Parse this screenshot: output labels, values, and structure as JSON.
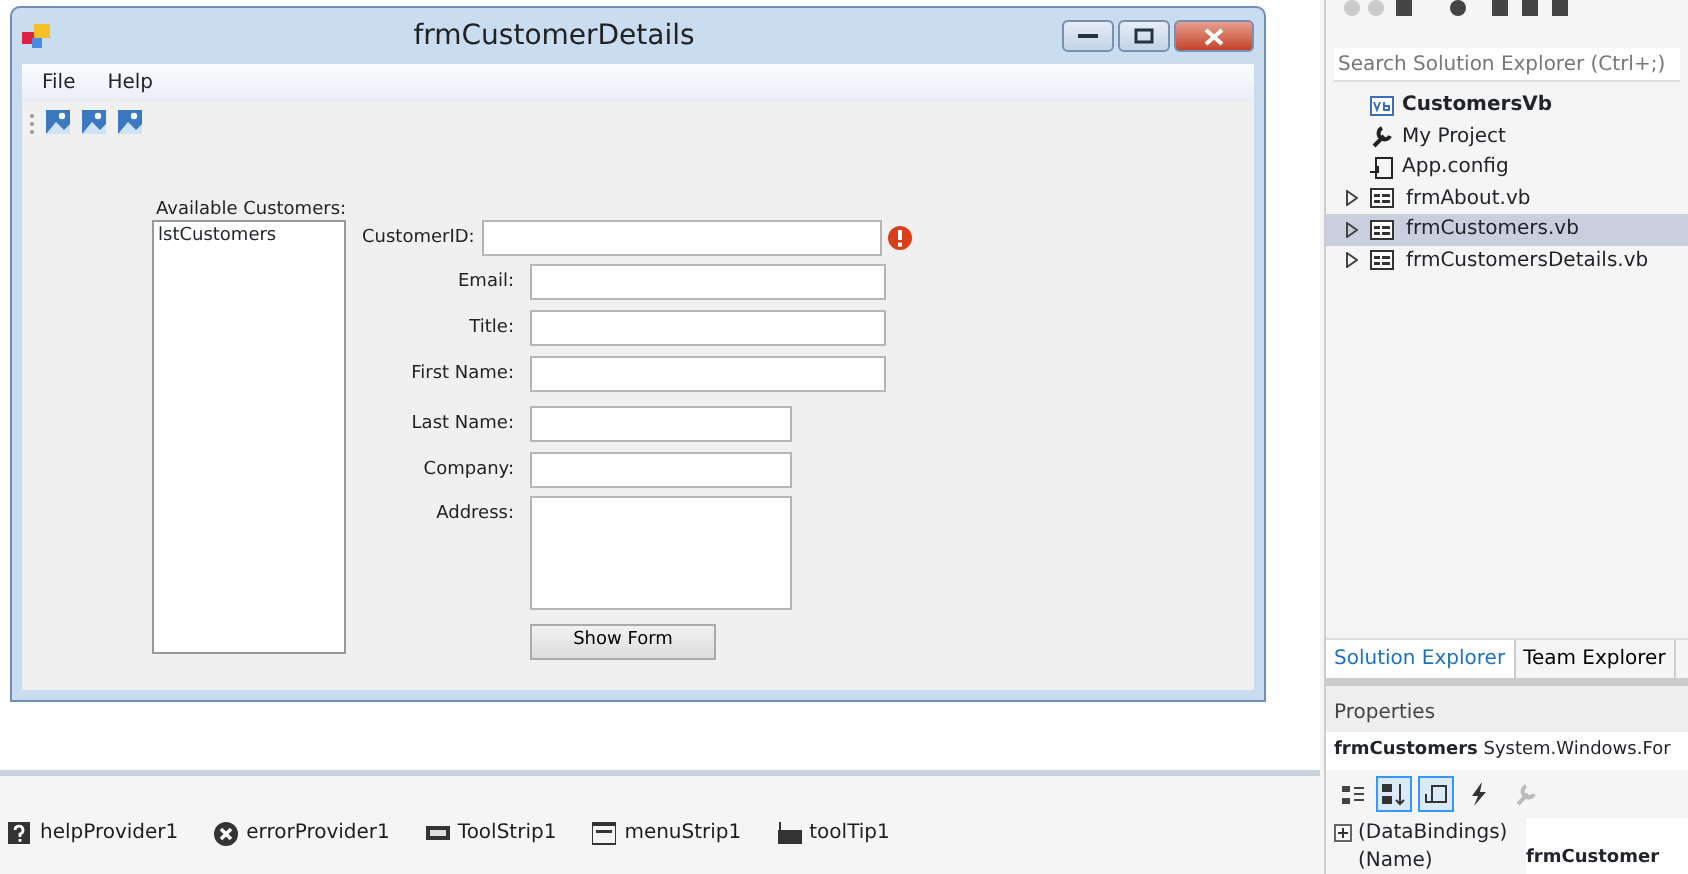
{
  "form": {
    "title": "frmCustomerDetails",
    "menu": [
      "File",
      "Help"
    ],
    "list": {
      "label": "Available Customers:",
      "items": [
        "lstCustomers"
      ]
    },
    "fields": [
      {
        "label": "CustomerID:",
        "kind": "wide",
        "error": true
      },
      {
        "label": "Email:",
        "kind": "text",
        "error": false
      },
      {
        "label": "Title:",
        "kind": "text",
        "error": false
      },
      {
        "label": "First Name:",
        "kind": "text",
        "error": false
      },
      {
        "label": "Last Name:",
        "kind": "short",
        "error": false
      },
      {
        "label": "Company:",
        "kind": "short",
        "error": false
      },
      {
        "label": "Address:",
        "kind": "multiline",
        "error": false
      }
    ],
    "button": "Show Form"
  },
  "component_tray": [
    {
      "label": "helpProvider1",
      "kind": "help"
    },
    {
      "label": "errorProvider1",
      "kind": "error"
    },
    {
      "label": "ToolStrip1",
      "kind": "toolstrip"
    },
    {
      "label": "menuStrip1",
      "kind": "menu"
    },
    {
      "label": "toolTip1",
      "kind": "tooltip"
    }
  ],
  "solution_explorer": {
    "search": {
      "placeholder": "Search Solution Explorer (Ctrl+;)"
    },
    "tree": [
      {
        "label": "CustomersVb",
        "kind": "project",
        "children": [
          {
            "label": "My Project",
            "kind": "wrench",
            "selected": false
          },
          {
            "label": "App.config",
            "kind": "config",
            "selected": false
          },
          {
            "label": "frmAbout.vb",
            "kind": "form",
            "expanded": false,
            "selected": false
          },
          {
            "label": "frmCustomers.vb",
            "kind": "form",
            "expanded": false,
            "selected": true
          },
          {
            "label": "frmCustomersDetails.vb",
            "kind": "form",
            "expanded": false,
            "selected": false
          }
        ]
      }
    ],
    "tabs": [
      {
        "label": "Solution Explorer",
        "selected": true
      },
      {
        "label": "Team Explorer",
        "selected": false
      }
    ]
  },
  "properties": {
    "title": "Properties",
    "object": "frmCustomers",
    "type": "System.Windows.For",
    "tools": [
      {
        "kind": "categorized",
        "selected": false
      },
      {
        "kind": "alphabetical",
        "selected": true
      },
      {
        "kind": "properties",
        "selected": true
      },
      {
        "kind": "events",
        "selected": false
      },
      {
        "kind": "pages",
        "selected": false
      }
    ],
    "rows": [
      {
        "name": "(DataBindings)",
        "value": "",
        "expandable": true
      },
      {
        "name": "(Name)",
        "value": "frmCustomer",
        "expandable": false
      }
    ]
  }
}
